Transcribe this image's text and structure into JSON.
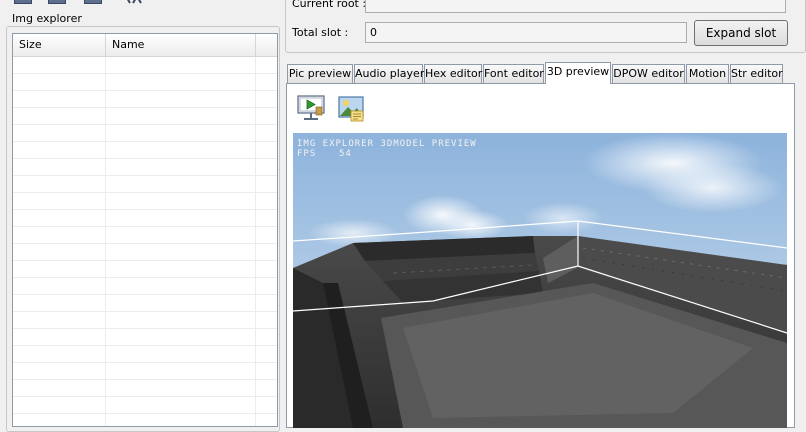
{
  "left_panel": {
    "title": "Img explorer",
    "columns": [
      "Size",
      "Name"
    ]
  },
  "top_panel": {
    "current_root_label": "Current root :",
    "current_root_value": "",
    "total_slot_label": "Total slot :",
    "total_slot_value": "0",
    "expand_button": "Expand slot"
  },
  "tabs": [
    {
      "label": "Pic preview",
      "active": false
    },
    {
      "label": "Audio player",
      "active": false
    },
    {
      "label": "Hex editor",
      "active": false
    },
    {
      "label": "Font editor",
      "active": false
    },
    {
      "label": "3D preview",
      "active": true
    },
    {
      "label": "DPOW editor",
      "active": false
    },
    {
      "label": "Motion",
      "active": false
    },
    {
      "label": "Str editor",
      "active": false
    }
  ],
  "toolbar": {
    "play_icon": "play-presentation-icon",
    "image_icon": "image-export-icon"
  },
  "viewport": {
    "hud_title": "IMG EXPLORER 3DMODEL PREVIEW",
    "fps_label": "FPS",
    "fps_value": "54"
  },
  "colors": {
    "sky_top": "#8fb4dc",
    "sky_bottom": "#c8dced",
    "model_dark": "#3c3c3c",
    "model_mid": "#5a5a5a",
    "bbox_line": "#ffffff",
    "accent": "#3c7fb1"
  }
}
